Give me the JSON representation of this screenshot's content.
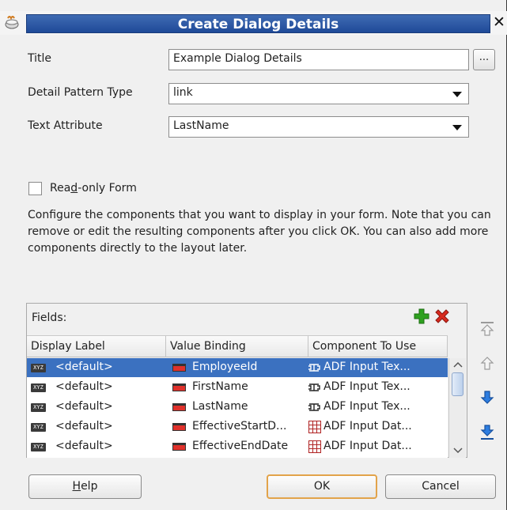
{
  "window": {
    "title": "Create Dialog Details",
    "close_glyph": "✕"
  },
  "form": {
    "title_label": "Title",
    "title_value": "Example Dialog Details",
    "browse_label": "...",
    "detail_pattern_label": "Detail Pattern Type",
    "detail_pattern_value": "link",
    "text_attribute_label": "Text Attribute",
    "text_attribute_value": "LastName",
    "readonly_label_pre": "Rea",
    "readonly_label_mnemonic": "d",
    "readonly_label_post": "-only Form",
    "readonly_checked": false
  },
  "description": "Configure the components that you want to display in your form. Note that you can remove or edit the resulting components after you click OK.  You can also add more components directly to the layout later.",
  "fields": {
    "label": "Fields:",
    "columns": [
      "Display Label",
      "Value Binding",
      "Component To Use"
    ],
    "type_badge": "XYZ",
    "rows": [
      {
        "label": "<default>",
        "binding": "EmployeeId",
        "component": "ADF Input Tex...",
        "component_icon": "input-text-icon",
        "selected": true
      },
      {
        "label": "<default>",
        "binding": "FirstName",
        "component": "ADF Input Tex...",
        "component_icon": "input-text-icon",
        "selected": false
      },
      {
        "label": "<default>",
        "binding": "LastName",
        "component": "ADF Input Tex...",
        "component_icon": "input-text-icon",
        "selected": false
      },
      {
        "label": "<default>",
        "binding": "EffectiveStartD...",
        "component": "ADF Input Dat...",
        "component_icon": "input-date-icon",
        "selected": false
      },
      {
        "label": "<default>",
        "binding": "EffectiveEndDate",
        "component": "ADF Input Dat...",
        "component_icon": "input-date-icon",
        "selected": false
      }
    ]
  },
  "buttons": {
    "help_mnemonic": "H",
    "help_rest": "elp",
    "ok": "OK",
    "cancel": "Cancel"
  },
  "colors": {
    "title_bar": "#2d5aa6",
    "selection": "#3b71c0",
    "add_green": "#2ea11f",
    "delete_red": "#d82a1e",
    "move_blue": "#1f6fd0"
  }
}
